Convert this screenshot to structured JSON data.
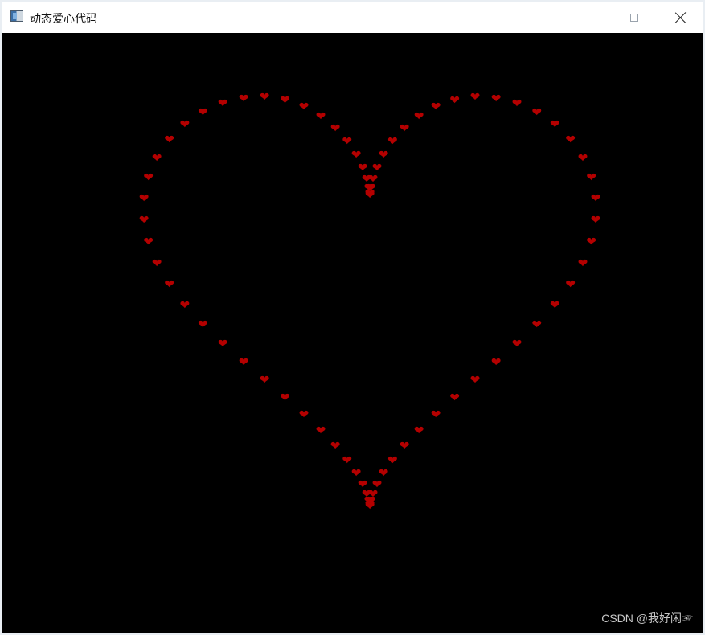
{
  "window": {
    "title": "动态爱心代码",
    "watermark": "CSDN @我好闲☞"
  },
  "icons": {
    "app": "app-window-icon",
    "minimize": "minimize-icon",
    "maximize": "maximize-icon",
    "close": "close-icon",
    "heart": "heart-icon"
  },
  "colors": {
    "background": "#000000",
    "heart": "#b40000",
    "titlebar": "#ffffff"
  },
  "heart_glyph": "❤"
}
